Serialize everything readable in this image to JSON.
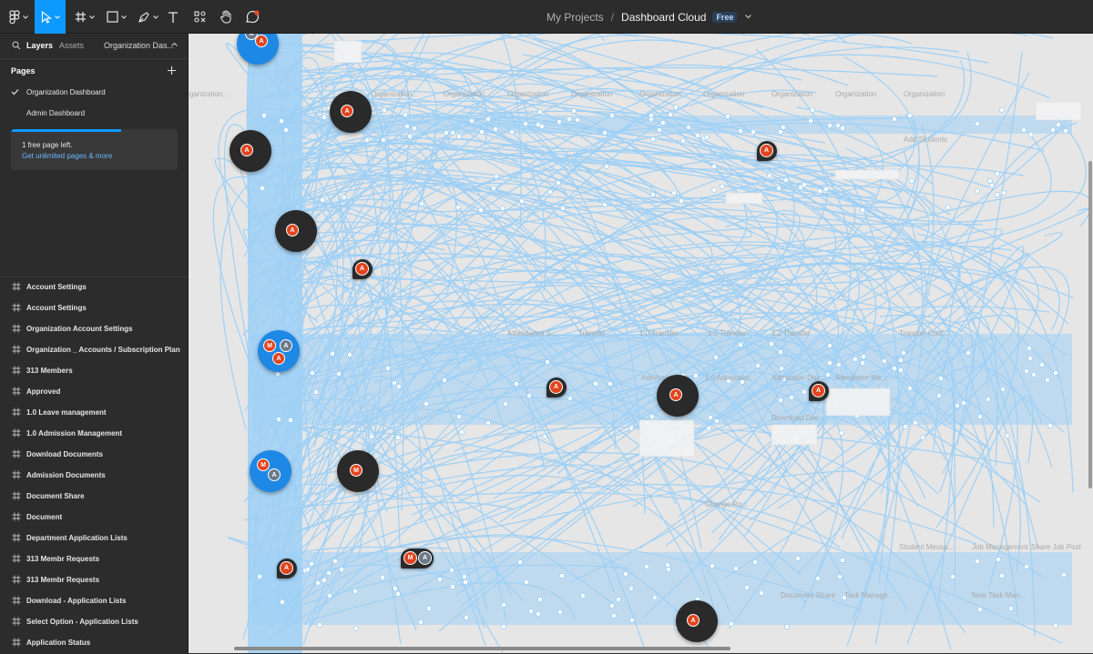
{
  "toolbar": {
    "tools": [
      "main-menu",
      "move",
      "frame",
      "shape",
      "pen",
      "text",
      "resources",
      "hand",
      "comment"
    ],
    "accent": "#0d99ff"
  },
  "breadcrumb": {
    "project": "My Projects",
    "separator": "/",
    "file": "Dashboard Cloud",
    "plan_badge": "Free"
  },
  "sidebar": {
    "tabs": {
      "layers": "Layers",
      "assets": "Assets",
      "current_page": "Organization Das..."
    },
    "pages_title": "Pages",
    "pages": [
      {
        "label": "Organization Dashboard",
        "selected": true
      },
      {
        "label": "Admin Dashboard",
        "selected": false
      }
    ],
    "notice": {
      "line1": "1 free page left.",
      "link": "Get unlimited pages & more",
      "progress": 0.66
    },
    "layers": [
      "Account Settings",
      "Account Settings",
      "Organization Account Settings",
      "Organization _ Accounts / Subscription Plan",
      "313 Members",
      "Approved",
      "1.0 Leave management",
      "1.0 Admission Management",
      "Download Documents",
      "Admission Documents",
      "Document Share",
      "Document",
      "Department Application Lists",
      "313 Membr Requests",
      "313 Membr Requests",
      "Download - Application Lists",
      "Select Option - Application Lists",
      "Application Status"
    ]
  },
  "canvas": {
    "background": "#e6e6e6",
    "flow_color": "#9fd0f5",
    "frame_labels": [
      "Organization...",
      "Organization...",
      "Organization...",
      "Organization",
      "Organization",
      "Organization",
      "Organization",
      "Organization",
      "Organization",
      "Organization",
      "Add Students",
      "Attendance S...",
      "Transfer",
      "1.0 Transfer",
      "1.2 Transfer",
      "1.2 Transfer",
      "Transfer Conf...",
      "Admission...",
      "1.0 Admission...",
      "Admission Doc...",
      "Admission Ma...",
      "Download Doc...",
      "Change Ro...",
      "Student Messa...",
      "Job Management",
      "Share Job Post",
      "New Task Man...",
      "Document Share",
      "Task Manage..."
    ],
    "collaborators": [
      "A",
      "M"
    ]
  }
}
